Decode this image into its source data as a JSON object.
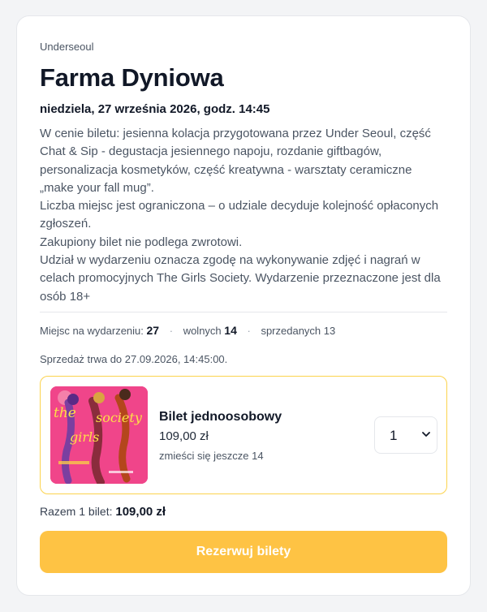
{
  "event": {
    "organizer": "Underseoul",
    "title": "Farma Dyniowa",
    "date": "niedziela, 27 września 2026, godz. 14:45",
    "description": [
      "W cenie biletu: jesienna kolacja przygotowana przez Under Seoul, część Chat & Sip - degustacja jesiennego napoju, rozdanie giftbagów, personalizacja kosmetyków, część kreatywna - warsztaty ceramiczne „make your fall mug”.",
      "Liczba miejsc jest ograniczona – o udziale decyduje kolejność opłaconych zgłoszeń.",
      "Zakupiony bilet nie podlega zwrotowi.",
      "Udział w wydarzeniu oznacza zgodę na wykonywanie zdjęć i nagrań w celach promocyjnych The Girls Society. Wydarzenie przeznaczone jest dla osób 18+"
    ]
  },
  "stats": {
    "seats_label": "Miejsc na wydarzeniu:",
    "seats_value": "27",
    "free_label": "wolnych",
    "free_value": "14",
    "sold_label": "sprzedanych",
    "sold_value": "13",
    "separator": "·"
  },
  "sale_info": "Sprzedaż trwa do 27.09.2026, 14:45:00.",
  "ticket": {
    "image_text": [
      "the",
      "society",
      "girls"
    ],
    "name": "Bilet jednoosobowy",
    "price": "109,00 zł",
    "remaining": "zmieści się jeszcze 14",
    "quantity": "1"
  },
  "summary": {
    "label": "Razem 1 bilet:",
    "amount": "109,00 zł"
  },
  "cta_label": "Rezerwuj bilety",
  "colors": {
    "accent": "#fec344",
    "ticket_border": "#fcd34d",
    "thumb_bg": "#f0458a"
  }
}
